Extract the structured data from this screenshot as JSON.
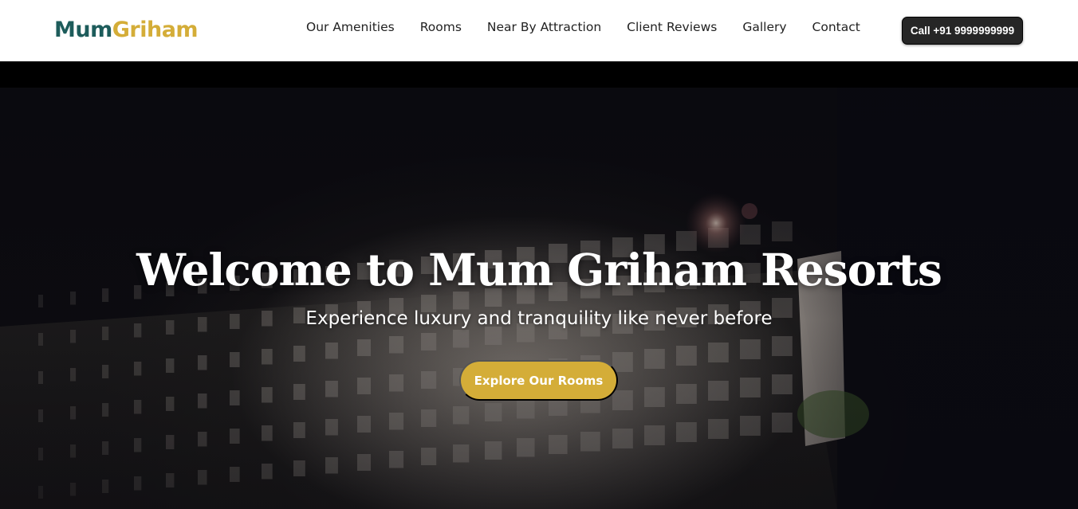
{
  "brand": {
    "part1": "Mum",
    "part2": "Griham",
    "color1": "#1d5c5b",
    "color2": "#d4ad38"
  },
  "nav": {
    "items": [
      {
        "label": "Our Amenities"
      },
      {
        "label": "Rooms"
      },
      {
        "label": "Near By Attraction"
      },
      {
        "label": "Client Reviews"
      },
      {
        "label": "Gallery"
      },
      {
        "label": "Contact"
      }
    ],
    "call_label": "Call +91 9999999999"
  },
  "hero": {
    "title": "Welcome to Mum Griham Resorts",
    "subtitle": "Experience luxury and tranquility like never before",
    "cta_label": "Explore Our Rooms",
    "accent": "#d4ad38"
  }
}
